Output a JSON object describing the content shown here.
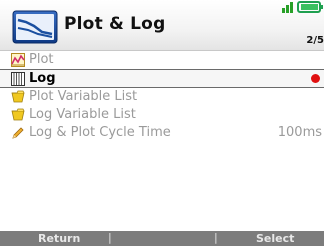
{
  "header": {
    "title": "Plot & Log",
    "page_indicator": "2/5",
    "app_icon": "plot-log-icon",
    "status_icons": [
      "battery-icon",
      "signal-icon"
    ]
  },
  "menu": {
    "items": [
      {
        "label": "Plot",
        "icon": "plot-icon",
        "enabled": false,
        "selected": false
      },
      {
        "label": "Log",
        "icon": "log-icon",
        "enabled": true,
        "selected": true,
        "indicator": "record-dot"
      },
      {
        "label": "Plot Variable List",
        "icon": "folder-icon",
        "enabled": false,
        "selected": false
      },
      {
        "label": "Log Variable List",
        "icon": "folder-icon",
        "enabled": false,
        "selected": false
      },
      {
        "label": "Log & Plot Cycle Time",
        "icon": "pencil-icon",
        "enabled": false,
        "selected": false,
        "value": "100ms"
      }
    ]
  },
  "footer": {
    "left_label": "Return",
    "separator": "|",
    "right_label": "Select"
  },
  "colors": {
    "selected_text": "#000000",
    "disabled_text": "#9a9a9a",
    "record_indicator": "#e01010",
    "footer_bg": "#7c7c7c",
    "icon_blue": "#1a4fa0"
  }
}
